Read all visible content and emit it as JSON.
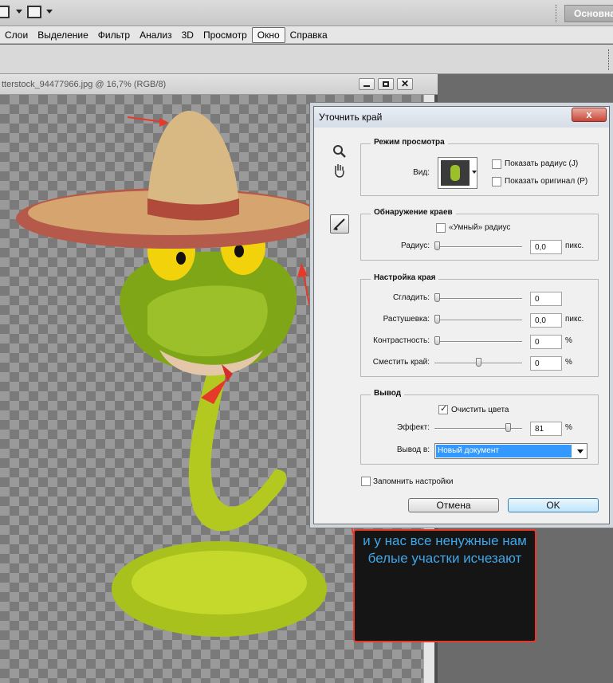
{
  "menubar": {
    "items": [
      "Слои",
      "Выделение",
      "Фильтр",
      "Анализ",
      "3D",
      "Просмотр",
      "Окно",
      "Справка"
    ],
    "active_index": 6
  },
  "topbar": {
    "workspace_label": "Основна"
  },
  "document": {
    "title": "tterstock_94477966.jpg @ 16,7% (RGB/8)"
  },
  "dialog": {
    "title": "Уточнить край",
    "close_glyph": "x",
    "view_mode": {
      "legend": "Режим просмотра",
      "view_label": "Вид:",
      "show_radius_label": "Показать радиус (J)",
      "show_original_label": "Показать оригинал (P)",
      "show_radius": false,
      "show_original": false
    },
    "edge_detection": {
      "legend": "Обнаружение краев",
      "smart_radius_label": "«Умный» радиус",
      "smart_radius": false,
      "radius_label": "Радиус:",
      "radius_value": "0,0",
      "radius_unit": "пикс.",
      "radius_level": 0
    },
    "adjust_edge": {
      "legend": "Настройка края",
      "smooth_label": "Сгладить:",
      "smooth_value": "0",
      "smooth_level": 0,
      "feather_label": "Растушевка:",
      "feather_value": "0,0",
      "feather_unit": "пикс.",
      "feather_level": 0,
      "contrast_label": "Контрастность:",
      "contrast_value": "0",
      "contrast_unit": "%",
      "contrast_level": 0,
      "shift_label": "Сместить край:",
      "shift_value": "0",
      "shift_unit": "%",
      "shift_level": 0.5
    },
    "output": {
      "legend": "Вывод",
      "decontaminate_label": "Очистить цвета",
      "decontaminate": true,
      "amount_label": "Эффект:",
      "amount_value": "81",
      "amount_unit": "%",
      "amount_level": 0.81,
      "output_to_label": "Вывод в:",
      "output_to_value": "Новый документ"
    },
    "remember_label": "Запомнить настройки",
    "remember": false,
    "cancel_label": "Отмена",
    "ok_label": "OK"
  },
  "annotation": {
    "text": "и у нас все ненужные нам белые участки исчезают",
    "border_color": "#e53a2a",
    "text_color": "#3fa7e8"
  },
  "colors": {
    "arrow": "#e53a2a",
    "output_select": "#3399ff"
  }
}
